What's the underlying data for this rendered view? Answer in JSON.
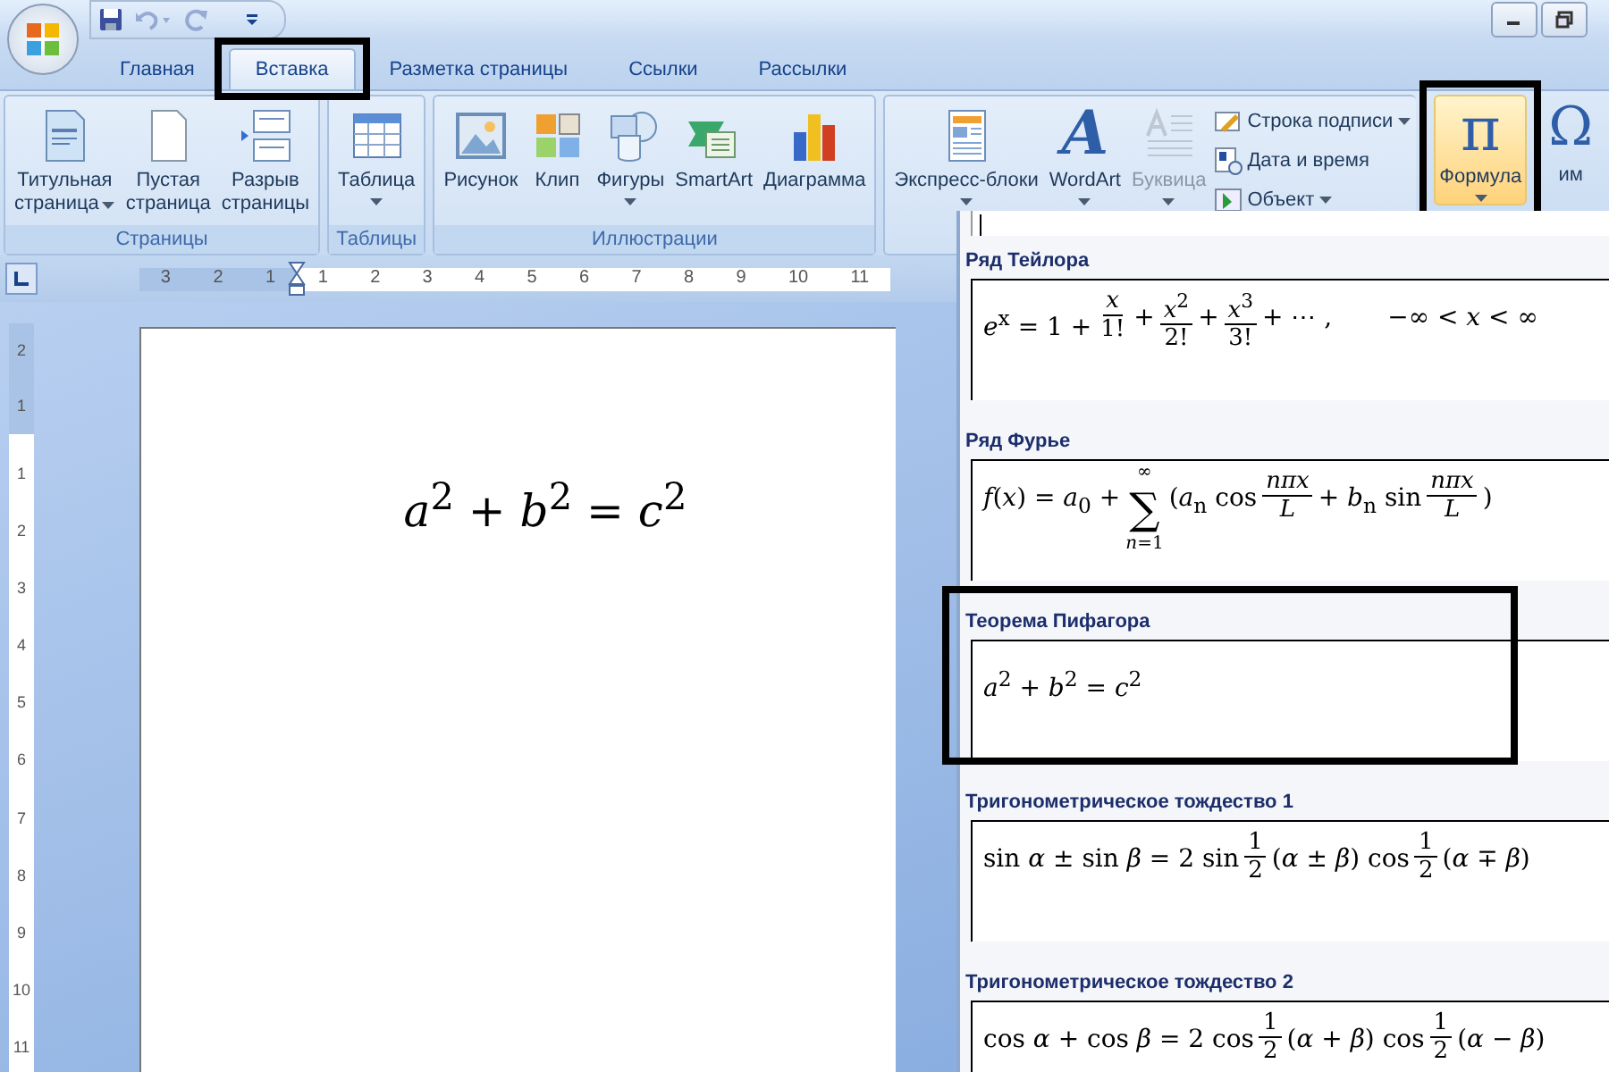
{
  "quick_access": [
    {
      "kind": "save",
      "disabled": false
    },
    {
      "kind": "undo",
      "disabled": true
    },
    {
      "kind": "redo",
      "disabled": true
    }
  ],
  "tabs": [
    {
      "label": "Главная",
      "selected": false,
      "highlighted": false
    },
    {
      "label": "Вставка",
      "selected": true,
      "highlighted": true
    },
    {
      "label": "Разметка страницы",
      "selected": false,
      "highlighted": false
    },
    {
      "label": "Ссылки",
      "selected": false,
      "highlighted": false
    },
    {
      "label": "Рассылки",
      "selected": false,
      "highlighted": false
    }
  ],
  "ribbon": {
    "groups": [
      {
        "label": "Страницы",
        "buttons": [
          {
            "kind": "cover",
            "lines": [
              "Титульная",
              "страница"
            ],
            "dropdown": true,
            "disabled": false
          },
          {
            "kind": "blank",
            "lines": [
              "Пустая",
              "страница"
            ],
            "dropdown": false,
            "disabled": false
          },
          {
            "kind": "pagebreak",
            "lines": [
              "Разрыв",
              "страницы"
            ],
            "dropdown": false,
            "disabled": false
          }
        ]
      },
      {
        "label": "Таблицы",
        "buttons": [
          {
            "kind": "table",
            "lines": [
              "Таблица"
            ],
            "dropdown": true,
            "disabled": false
          }
        ]
      },
      {
        "label": "Иллюстрации",
        "buttons": [
          {
            "kind": "picture",
            "lines": [
              "Рисунок"
            ],
            "dropdown": false,
            "disabled": false
          },
          {
            "kind": "clip",
            "lines": [
              "Клип"
            ],
            "dropdown": false,
            "disabled": false
          },
          {
            "kind": "shapes",
            "lines": [
              "Фигуры"
            ],
            "dropdown": true,
            "disabled": false
          },
          {
            "kind": "smartart",
            "lines": [
              "SmartArt"
            ],
            "dropdown": false,
            "disabled": false
          },
          {
            "kind": "chart",
            "lines": [
              "Диаграмма"
            ],
            "dropdown": false,
            "disabled": false
          }
        ]
      }
    ],
    "text_buttons": [
      {
        "kind": "quickparts",
        "lines": [
          "Экспресс-блоки"
        ],
        "dropdown": true,
        "disabled": false
      },
      {
        "kind": "wordart",
        "glyph": "A",
        "lines": [
          "WordArt"
        ],
        "dropdown": true,
        "disabled": false
      },
      {
        "kind": "dropcap",
        "lines": [
          "Буквица"
        ],
        "dropdown": true,
        "disabled": true
      }
    ],
    "small_buttons": [
      {
        "kind": "signature",
        "label": "Строка подписи",
        "dropdown": true
      },
      {
        "kind": "datetime",
        "label": "Дата и время",
        "dropdown": false
      },
      {
        "kind": "object",
        "label": "Объект",
        "dropdown": true
      }
    ],
    "equation_button": {
      "glyph": "π",
      "label": "Формула",
      "dropdown": true,
      "pressed": true,
      "highlighted": true
    },
    "symbol_button": {
      "glyph": "Ω",
      "label": "им"
    }
  },
  "ruler": {
    "left_numbers": [
      "3",
      "2",
      "1"
    ],
    "right_numbers": [
      "1",
      "2",
      "3",
      "4",
      "5",
      "6",
      "7",
      "8",
      "9",
      "10",
      "11"
    ]
  },
  "vertical_ruler": {
    "top_numbers": [
      "2",
      "1"
    ],
    "numbers": [
      "1",
      "2",
      "3",
      "4",
      "5",
      "6",
      "7",
      "8",
      "9",
      "10",
      "11"
    ]
  },
  "document": {
    "formula": "*a*$^{2}$ + *b*$^{2}$ = *c*$^{2}$"
  },
  "gallery": {
    "items": [
      {
        "title": "Ряд Тейлора",
        "highlighted": false,
        "parts": [
          {
            "kind": "text",
            "text": "*e*$^{x}$ = 1 +"
          },
          {
            "kind": "frac",
            "num": "*x*",
            "den": "1!"
          },
          {
            "kind": "text",
            "text": "+"
          },
          {
            "kind": "frac",
            "num": "*x*$^{2}$",
            "den": "2!"
          },
          {
            "kind": "text",
            "text": "+"
          },
          {
            "kind": "frac",
            "num": "*x*$^{3}$",
            "den": "3!"
          },
          {
            "kind": "text",
            "text": "+ ⋯ ,"
          },
          {
            "kind": "spaced",
            "text": "−∞ < *x* < ∞"
          }
        ]
      },
      {
        "title": "Ряд Фурье",
        "highlighted": false,
        "parts": [
          {
            "kind": "text",
            "text": "*f*(*x*) = *a*$_{0}$ +"
          },
          {
            "kind": "sum",
            "symbol": "∑",
            "over": "∞",
            "under": "*n*=1"
          },
          {
            "kind": "text",
            "text": "(*a*$_{n}$ cos"
          },
          {
            "kind": "frac",
            "num": "*nπx*",
            "den": "*L*"
          },
          {
            "kind": "text",
            "text": "+ *b*$_{n}$ sin"
          },
          {
            "kind": "frac",
            "num": "*nπx*",
            "den": "*L*"
          },
          {
            "kind": "text",
            "text": ")"
          }
        ]
      },
      {
        "title": "Теорема Пифагора",
        "highlighted": true,
        "parts": [
          {
            "kind": "text",
            "text": "*a*$^{2}$ + *b*$^{2}$ = *c*$^{2}$"
          }
        ]
      },
      {
        "title": "Тригонометрическое тождество 1",
        "highlighted": false,
        "parts": [
          {
            "kind": "text",
            "text": "sin *α* ± sin *β* = 2 sin"
          },
          {
            "kind": "frac",
            "num": "1",
            "den": "2"
          },
          {
            "kind": "text",
            "text": "(*α* ± *β*) cos"
          },
          {
            "kind": "frac",
            "num": "1",
            "den": "2"
          },
          {
            "kind": "text",
            "text": "(*α* ∓ *β*)"
          }
        ]
      },
      {
        "title": "Тригонометрическое тождество 2",
        "highlighted": false,
        "parts": [
          {
            "kind": "text",
            "text": "cos *α* + cos *β* = 2 cos"
          },
          {
            "kind": "frac",
            "num": "1",
            "den": "2"
          },
          {
            "kind": "text",
            "text": "(*α* + *β*) cos"
          },
          {
            "kind": "frac",
            "num": "1",
            "den": "2"
          },
          {
            "kind": "text",
            "text": "(*α* − *β*)"
          }
        ]
      }
    ]
  }
}
